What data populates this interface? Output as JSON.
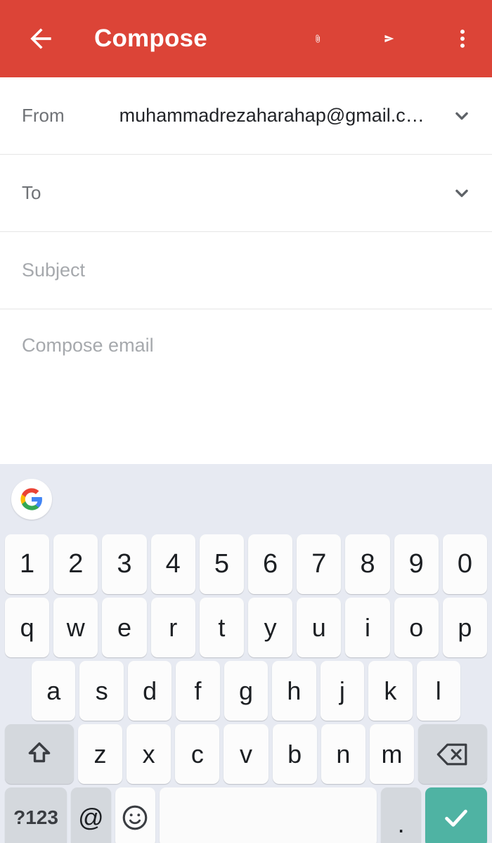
{
  "appbar": {
    "title": "Compose",
    "back_icon": "arrow-left-icon",
    "attach_icon": "paperclip-icon",
    "send_icon": "send-icon",
    "more_icon": "overflow-menu-icon",
    "background_color": "#dc4437",
    "text_color": "#ffffff"
  },
  "compose": {
    "from": {
      "label": "From",
      "value": "muhammadrezaharahap@gmail.c…",
      "expand_icon": "chevron-down-icon"
    },
    "to": {
      "label": "To",
      "value": "",
      "placeholder": "To",
      "expand_icon": "chevron-down-icon"
    },
    "subject": {
      "label": "Subject",
      "value": "",
      "placeholder": "Subject"
    },
    "body": {
      "value": "",
      "placeholder": "Compose email"
    }
  },
  "keyboard": {
    "background_color": "#e7eaf2",
    "key_color": "#fcfcfc",
    "modifier_key_color": "#d4d8dd",
    "enter_key_color": "#4fb3a3",
    "suggestion_strip": {
      "logo_icon": "google-g-icon"
    },
    "rows": {
      "numbers": [
        "1",
        "2",
        "3",
        "4",
        "5",
        "6",
        "7",
        "8",
        "9",
        "0"
      ],
      "top": [
        "q",
        "w",
        "e",
        "r",
        "t",
        "y",
        "u",
        "i",
        "o",
        "p"
      ],
      "home": [
        "a",
        "s",
        "d",
        "f",
        "g",
        "h",
        "j",
        "k",
        "l"
      ],
      "bottom": [
        "z",
        "x",
        "c",
        "v",
        "b",
        "n",
        "m"
      ]
    },
    "shift_key": {
      "label": "",
      "icon": "shift-arrow-icon"
    },
    "backspace_key": {
      "label": "",
      "icon": "backspace-icon"
    },
    "symbols_key": {
      "label": "?123"
    },
    "at_key": {
      "label": "@"
    },
    "emoji_key": {
      "label": "",
      "icon": "emoji-smiley-icon"
    },
    "space_key": {
      "label": ""
    },
    "period_key": {
      "label": "."
    },
    "enter_key": {
      "label": "",
      "icon": "checkmark-icon"
    }
  }
}
